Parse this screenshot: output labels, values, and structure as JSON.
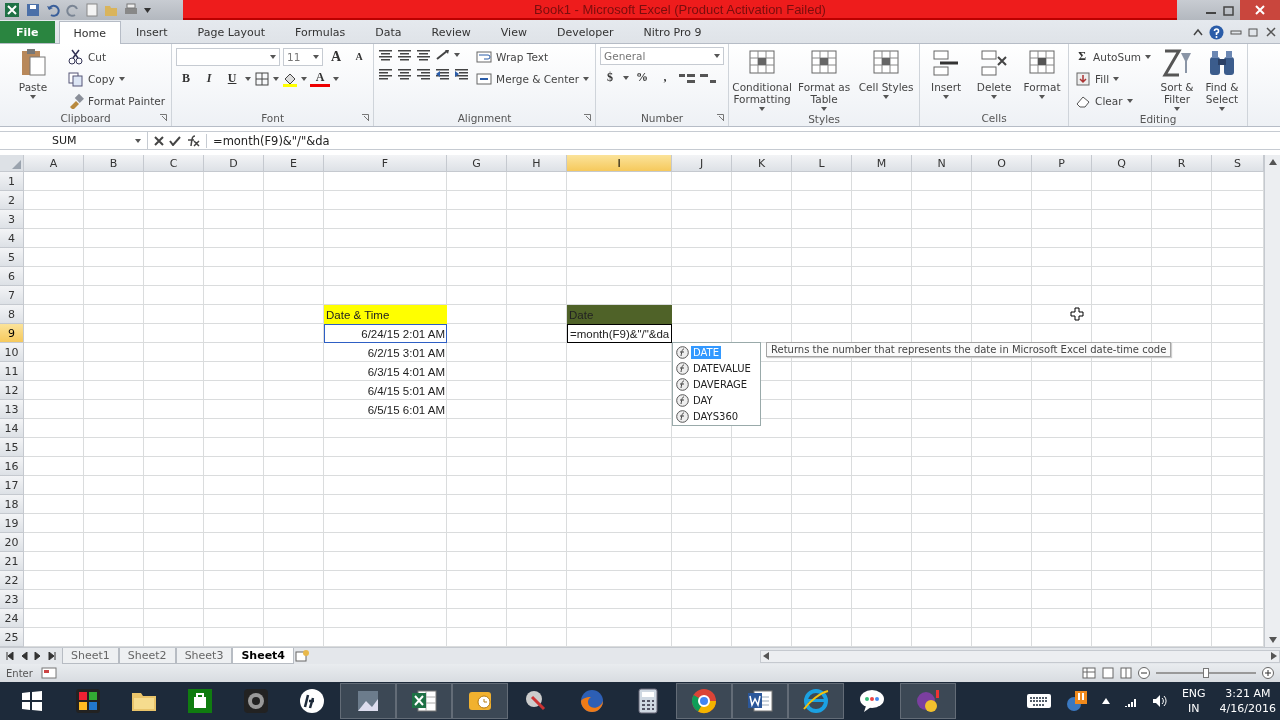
{
  "window": {
    "title": "Book1 - Microsoft Excel (Product Activation Failed)"
  },
  "ribbon_tabs": [
    {
      "label": "File",
      "kind": "file",
      "selected": false
    },
    {
      "label": "Home",
      "kind": "tab",
      "selected": true
    },
    {
      "label": "Insert",
      "kind": "tab",
      "selected": false
    },
    {
      "label": "Page Layout",
      "kind": "tab",
      "selected": false
    },
    {
      "label": "Formulas",
      "kind": "tab",
      "selected": false
    },
    {
      "label": "Data",
      "kind": "tab",
      "selected": false
    },
    {
      "label": "Review",
      "kind": "tab",
      "selected": false
    },
    {
      "label": "View",
      "kind": "tab",
      "selected": false
    },
    {
      "label": "Developer",
      "kind": "tab",
      "selected": false
    },
    {
      "label": "Nitro Pro 9",
      "kind": "tab",
      "selected": false
    }
  ],
  "ribbon_groups": [
    {
      "kind": "clipboard",
      "label": "Clipboard",
      "controls": [
        "Paste",
        "Cut",
        "Copy",
        "Format Painter"
      ]
    },
    {
      "kind": "font",
      "label": "Font",
      "controls": [
        "11",
        "A",
        "A",
        "B",
        "I",
        "U",
        "A"
      ]
    },
    {
      "kind": "alignment",
      "label": "Alignment",
      "controls": [
        "Wrap Text",
        "Merge & Center"
      ]
    },
    {
      "kind": "number",
      "label": "Number",
      "controls": [
        "General",
        "$",
        "%",
        ","
      ]
    },
    {
      "kind": "styles",
      "label": "Styles",
      "controls": [
        "Conditional Formatting",
        "Format as Table",
        "Cell Styles"
      ]
    },
    {
      "kind": "cells",
      "label": "Cells",
      "controls": [
        "Insert",
        "Delete",
        "Format"
      ]
    },
    {
      "kind": "editing",
      "label": "Editing",
      "controls": [
        "Σ",
        "AutoSum",
        "Fill",
        "Clear",
        "Sort & Filter",
        "Find & Select"
      ]
    }
  ],
  "formula_bar": {
    "name_box": "SUM",
    "formula": "=month(F9)&\"/\"&da"
  },
  "grid": {
    "columns": [
      {
        "label": "A",
        "selected": false
      },
      {
        "label": "B",
        "selected": false
      },
      {
        "label": "C",
        "selected": false
      },
      {
        "label": "D",
        "selected": false
      },
      {
        "label": "E",
        "selected": false
      },
      {
        "label": "F",
        "selected": false
      },
      {
        "label": "G",
        "selected": false
      },
      {
        "label": "H",
        "selected": false
      },
      {
        "label": "I",
        "selected": true
      },
      {
        "label": "J",
        "selected": false
      },
      {
        "label": "K",
        "selected": false
      },
      {
        "label": "L",
        "selected": false
      },
      {
        "label": "M",
        "selected": false
      },
      {
        "label": "N",
        "selected": false
      },
      {
        "label": "O",
        "selected": false
      },
      {
        "label": "P",
        "selected": false
      },
      {
        "label": "Q",
        "selected": false
      },
      {
        "label": "R",
        "selected": false
      },
      {
        "label": "S",
        "selected": false
      }
    ],
    "rows": [
      {
        "header": "1",
        "selected": false,
        "cells": []
      },
      {
        "header": "2",
        "selected": false,
        "cells": []
      },
      {
        "header": "3",
        "selected": false,
        "cells": []
      },
      {
        "header": "4",
        "selected": false,
        "cells": []
      },
      {
        "header": "5",
        "selected": false,
        "cells": []
      },
      {
        "header": "6",
        "selected": false,
        "cells": []
      },
      {
        "header": "7",
        "selected": false,
        "cells": []
      },
      {
        "header": "8",
        "selected": false,
        "cells": [
          {
            "text": "Date & Time",
            "kind": "heading",
            "color": "#ffff00"
          },
          {
            "text": "Date",
            "kind": "heading",
            "color": "#4f6228"
          }
        ]
      },
      {
        "header": "9",
        "selected": true,
        "cells": [
          {
            "text": "6/24/15 2:01 AM",
            "kind": "reference"
          },
          {
            "text": "=month(F9)&\"/\"&da",
            "kind": "editing"
          }
        ]
      },
      {
        "header": "10",
        "selected": false,
        "cells": [
          {
            "text": "6/2/15 3:01 AM",
            "kind": "value"
          }
        ]
      },
      {
        "header": "11",
        "selected": false,
        "cells": [
          {
            "text": "6/3/15 4:01 AM",
            "kind": "value"
          }
        ]
      },
      {
        "header": "12",
        "selected": false,
        "cells": [
          {
            "text": "6/4/15 5:01 AM",
            "kind": "value"
          }
        ]
      },
      {
        "header": "13",
        "selected": false,
        "cells": [
          {
            "text": "6/5/15 6:01 AM",
            "kind": "value"
          }
        ]
      },
      {
        "header": "14",
        "selected": false,
        "cells": []
      },
      {
        "header": "15",
        "selected": false,
        "cells": []
      },
      {
        "header": "16",
        "selected": false,
        "cells": []
      },
      {
        "header": "17",
        "selected": false,
        "cells": []
      },
      {
        "header": "18",
        "selected": false,
        "cells": []
      },
      {
        "header": "19",
        "selected": false,
        "cells": []
      },
      {
        "header": "20",
        "selected": false,
        "cells": []
      },
      {
        "header": "21",
        "selected": false,
        "cells": []
      },
      {
        "header": "22",
        "selected": false,
        "cells": []
      },
      {
        "header": "23",
        "selected": false,
        "cells": []
      },
      {
        "header": "24",
        "selected": false,
        "cells": []
      },
      {
        "header": "25",
        "selected": false,
        "cells": []
      }
    ]
  },
  "autocomplete": {
    "items": [
      {
        "label": "DATE",
        "selected": true
      },
      {
        "label": "DATEVALUE",
        "selected": false
      },
      {
        "label": "DAVERAGE",
        "selected": false
      },
      {
        "label": "DAY",
        "selected": false
      },
      {
        "label": "DAYS360",
        "selected": false
      }
    ],
    "tooltip": "Returns the number that represents the date in Microsoft Excel date-time code"
  },
  "sheet_tabs": [
    {
      "label": "Sheet1",
      "selected": false
    },
    {
      "label": "Sheet2",
      "selected": false
    },
    {
      "label": "Sheet3",
      "selected": false
    },
    {
      "label": "Sheet4",
      "selected": true
    }
  ],
  "status_bar": {
    "mode": "Enter",
    "zoom": {
      "level": 0.5
    }
  },
  "taskbar": {
    "apps": [
      {
        "kind": "games",
        "open": false
      },
      {
        "kind": "folder",
        "open": false
      },
      {
        "kind": "store",
        "open": false
      },
      {
        "kind": "webcam",
        "open": false
      },
      {
        "kind": "hp",
        "open": false
      },
      {
        "kind": "app",
        "open": true
      },
      {
        "kind": "excel",
        "open": true
      },
      {
        "kind": "outlook",
        "open": true
      },
      {
        "kind": "tool",
        "open": false
      },
      {
        "kind": "firefox",
        "open": false
      },
      {
        "kind": "calculator",
        "open": false
      },
      {
        "kind": "chrome",
        "open": true
      },
      {
        "kind": "word",
        "open": true
      },
      {
        "kind": "ie",
        "open": true
      },
      {
        "kind": "talk",
        "open": false
      },
      {
        "kind": "messenger",
        "open": true
      }
    ],
    "language": [
      "ENG",
      "IN"
    ],
    "time": "3:21 AM",
    "date": "4/16/2016"
  }
}
